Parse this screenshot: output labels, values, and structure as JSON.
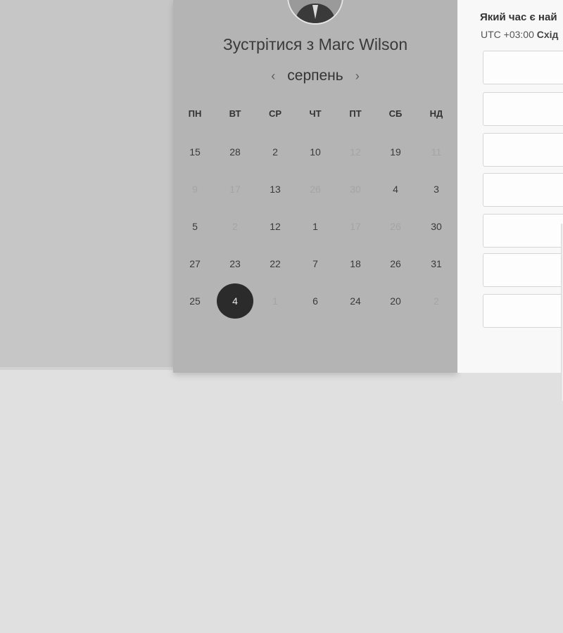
{
  "meeting": {
    "title": "Зустрітися з Marc Wilson"
  },
  "calendar": {
    "month": "серпень",
    "prev_icon": "chevron-left-icon",
    "next_icon": "chevron-right-icon",
    "weekdays": [
      "ПН",
      "ВТ",
      "СР",
      "ЧТ",
      "ПТ",
      "СБ",
      "НД"
    ],
    "weeks": [
      [
        {
          "label": "15",
          "available": true
        },
        {
          "label": "28",
          "available": true
        },
        {
          "label": "2",
          "available": true
        },
        {
          "label": "10",
          "available": true
        },
        {
          "label": "12",
          "available": false
        },
        {
          "label": "19",
          "available": true
        },
        {
          "label": "11",
          "available": false
        }
      ],
      [
        {
          "label": "9",
          "available": false
        },
        {
          "label": "17",
          "available": false
        },
        {
          "label": "13",
          "available": true
        },
        {
          "label": "26",
          "available": false
        },
        {
          "label": "30",
          "available": false
        },
        {
          "label": "4",
          "available": true
        },
        {
          "label": "3",
          "available": true
        }
      ],
      [
        {
          "label": "5",
          "available": true
        },
        {
          "label": "2",
          "available": false
        },
        {
          "label": "12",
          "available": true
        },
        {
          "label": "1",
          "available": true
        },
        {
          "label": "17",
          "available": false
        },
        {
          "label": "26",
          "available": false
        },
        {
          "label": "30",
          "available": true
        }
      ],
      [
        {
          "label": "27",
          "available": true
        },
        {
          "label": "23",
          "available": true
        },
        {
          "label": "22",
          "available": true
        },
        {
          "label": "7",
          "available": true
        },
        {
          "label": "18",
          "available": true
        },
        {
          "label": "26",
          "available": true
        },
        {
          "label": "31",
          "available": true
        }
      ],
      [
        {
          "label": "25",
          "available": true
        },
        {
          "label": "4",
          "available": true,
          "selected": true
        },
        {
          "label": "1",
          "available": false
        },
        {
          "label": "6",
          "available": true
        },
        {
          "label": "24",
          "available": true
        },
        {
          "label": "20",
          "available": true
        },
        {
          "label": "2",
          "available": false
        }
      ]
    ]
  },
  "time_panel": {
    "title": "Який час є най",
    "timezone_offset": "UTC +03:00",
    "timezone_name": "Схід",
    "slot_count": 7
  },
  "colors": {
    "selected_day_bg": "#2b2b2b",
    "panel_bg": "#b4b4b4",
    "muted_day": "#a4a4a4"
  }
}
